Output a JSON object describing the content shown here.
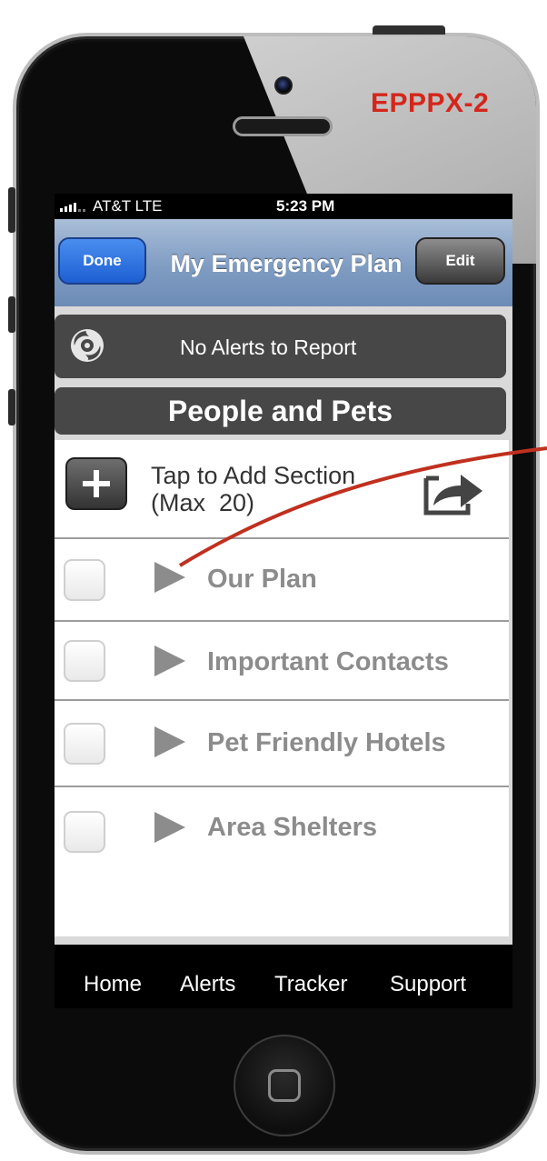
{
  "document_code": "EPPPX-2",
  "status_bar": {
    "carrier": "AT&T LTE",
    "time": "5:23 PM",
    "signal_icon": "signal-bars-icon"
  },
  "nav_bar": {
    "title": "My Emergency Plan",
    "done_label": "Done",
    "edit_label": "Edit"
  },
  "alert_bar": {
    "icon": "hurricane-icon",
    "message": "No Alerts to Report"
  },
  "section": {
    "title": "People and Pets"
  },
  "add_section": {
    "icon": "plus-icon",
    "line1": "Tap to Add Section",
    "line2": "(Max  20)",
    "share_icon": "share-arrow-icon"
  },
  "list": {
    "items": [
      {
        "label": "Our Plan",
        "checked": false
      },
      {
        "label": "Important Contacts",
        "checked": false
      },
      {
        "label": "Pet Friendly Hotels",
        "checked": false
      },
      {
        "label": "Area Shelters",
        "checked": false
      }
    ]
  },
  "tab_bar": {
    "tabs": [
      {
        "label": "Home"
      },
      {
        "label": "Alerts"
      },
      {
        "label": "Tracker"
      },
      {
        "label": "Support"
      }
    ]
  },
  "colors": {
    "annotation": "#c0301f",
    "done_button": "#1d5fd2",
    "nav_bar": "#7f9cc2",
    "dark_bar": "#474747",
    "row_text": "#8c8c8c"
  }
}
